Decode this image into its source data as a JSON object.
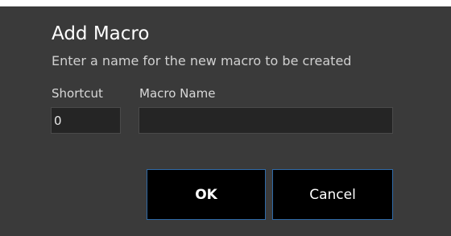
{
  "dialog": {
    "title": "Add Macro",
    "subtitle": "Enter a name for the new macro to be created"
  },
  "form": {
    "shortcut_label": "Shortcut",
    "shortcut_value": "0",
    "macro_name_label": "Macro Name",
    "macro_name_value": ""
  },
  "buttons": {
    "ok_label": "OK",
    "cancel_label": "Cancel"
  },
  "colors": {
    "dialog_background": "#3a3a3a",
    "input_background": "#252525",
    "button_background": "#000000",
    "button_border": "#2f6aa8"
  }
}
